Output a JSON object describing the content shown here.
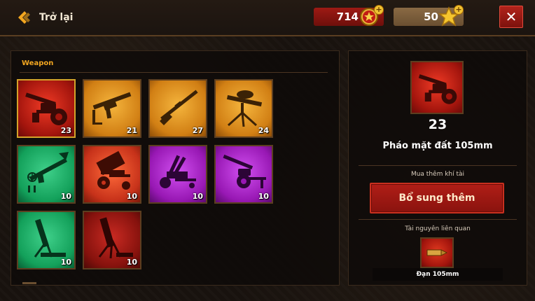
{
  "header": {
    "back_label": "Trở lại",
    "currency_medal": "714",
    "currency_star": "50",
    "close_label": "✕"
  },
  "inventory": {
    "section_label": "Weapon",
    "items": [
      {
        "name": "howitzer",
        "count": "23",
        "color": "red",
        "selected": true
      },
      {
        "name": "smg",
        "count": "21",
        "color": "gold"
      },
      {
        "name": "rifle",
        "count": "27",
        "color": "gold"
      },
      {
        "name": "machine-gun",
        "count": "24",
        "color": "gold"
      },
      {
        "name": "rocket-launcher",
        "count": "10",
        "color": "green"
      },
      {
        "name": "multiple-rocket-launcher",
        "count": "10",
        "color": "orange"
      },
      {
        "name": "anti-air-gun",
        "count": "10",
        "color": "purple"
      },
      {
        "name": "field-gun",
        "count": "10",
        "color": "purple"
      },
      {
        "name": "mortar",
        "count": "10",
        "color": "green"
      },
      {
        "name": "heavy-mortar",
        "count": "10",
        "color": "darkred"
      }
    ]
  },
  "detail": {
    "count": "23",
    "name": "Pháo mặt đất 105mm",
    "buy_label": "Mua thêm khí tài",
    "supply_button": "Bổ sung thêm",
    "resource_label": "Tài nguyên liên quan",
    "resource_name": "Đạn 105mm"
  },
  "colors": {
    "accent_orange": "#f2a620",
    "panel_border": "#5c3e20",
    "button_red": "#b01e17"
  }
}
